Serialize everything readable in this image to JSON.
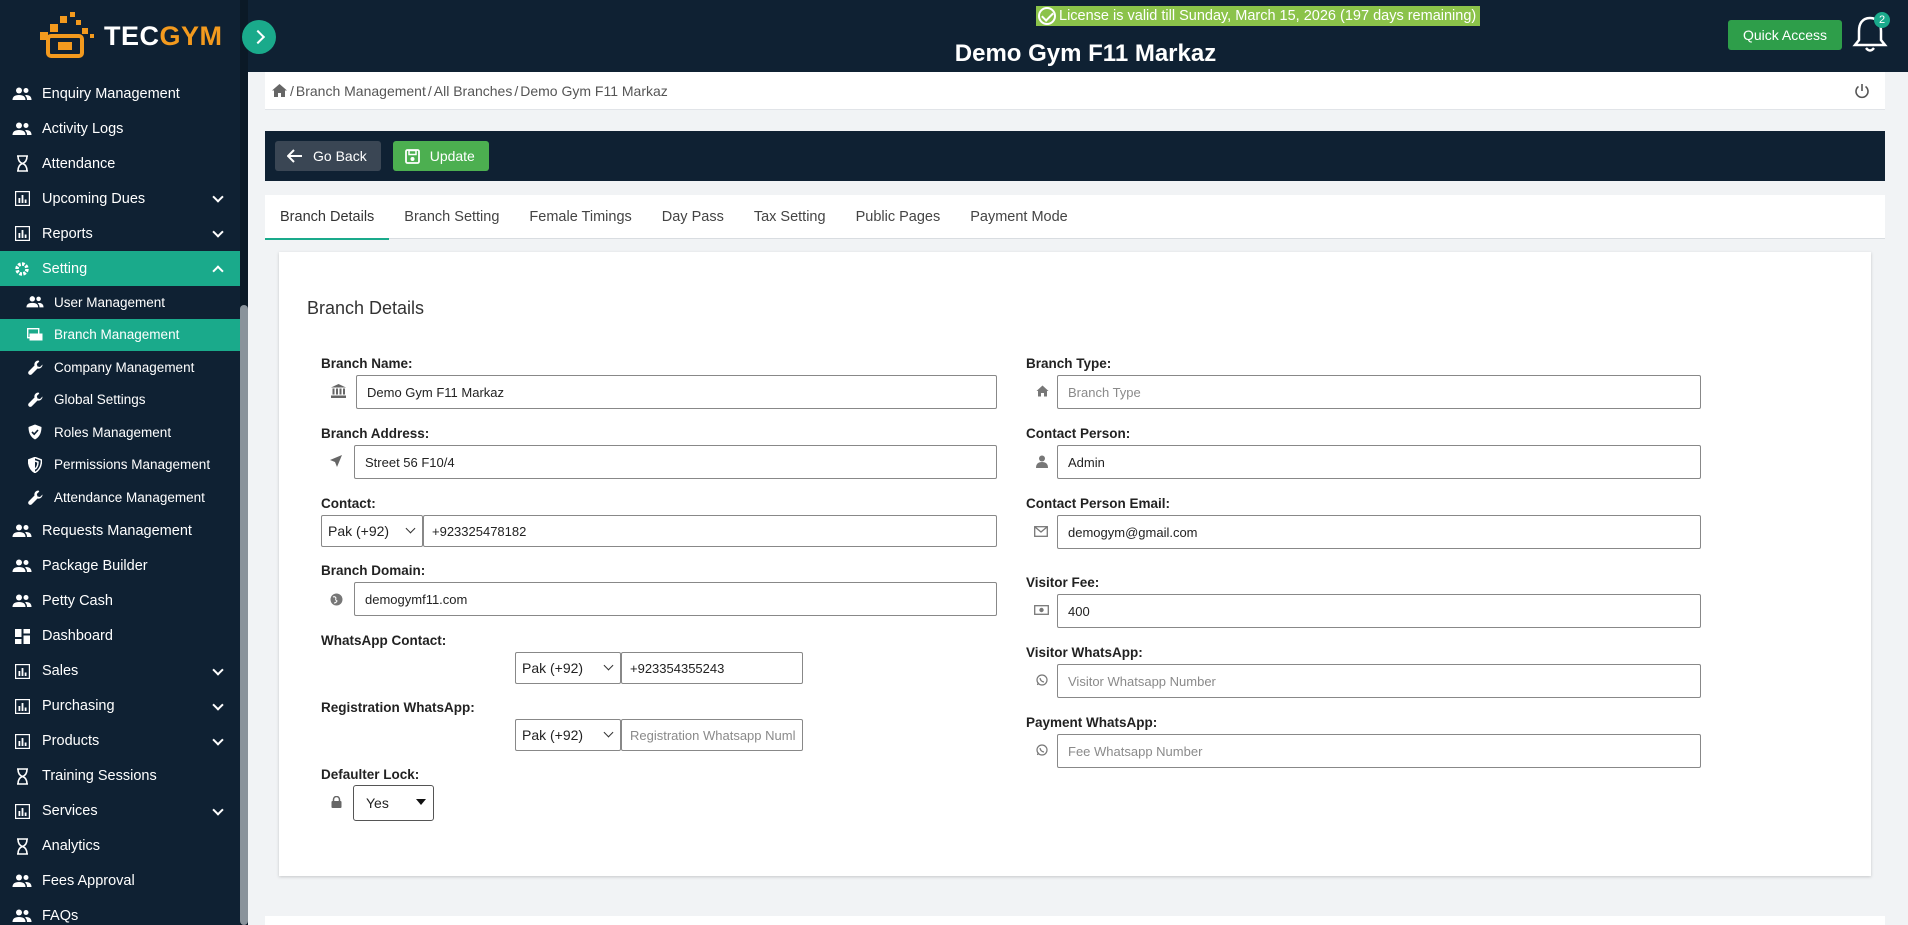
{
  "app": {
    "logo_tec": "TEC",
    "logo_gym": "GYM"
  },
  "sidebar": {
    "items": [
      {
        "label": "Enquiry Management",
        "icon": "users-icon",
        "has_chevron": false
      },
      {
        "label": "Activity Logs",
        "icon": "users-icon",
        "has_chevron": false
      },
      {
        "label": "Attendance",
        "icon": "hourglass-icon",
        "has_chevron": false
      },
      {
        "label": "Upcoming Dues",
        "icon": "bar-chart-icon",
        "has_chevron": true
      },
      {
        "label": "Reports",
        "icon": "bar-chart-icon",
        "has_chevron": true
      },
      {
        "label": "Setting",
        "icon": "gear-icon",
        "has_chevron": true,
        "active": true
      }
    ],
    "setting_sub": [
      {
        "label": "User Management",
        "icon": "users-icon"
      },
      {
        "label": "Branch Management",
        "icon": "branch-icon",
        "active": true
      },
      {
        "label": "Company Management",
        "icon": "wrench-icon"
      },
      {
        "label": "Global Settings",
        "icon": "wrench-icon"
      },
      {
        "label": "Roles Management",
        "icon": "shield-check-icon"
      },
      {
        "label": "Permissions Management",
        "icon": "shield-half-icon"
      },
      {
        "label": "Attendance Management",
        "icon": "wrench-icon"
      }
    ],
    "items_after": [
      {
        "label": "Requests Management",
        "icon": "users-icon",
        "has_chevron": false
      },
      {
        "label": "Package Builder",
        "icon": "users-icon",
        "has_chevron": false
      },
      {
        "label": "Petty Cash",
        "icon": "users-icon",
        "has_chevron": false
      },
      {
        "label": "Dashboard",
        "icon": "dashboard-icon",
        "has_chevron": false
      },
      {
        "label": "Sales",
        "icon": "bar-chart-icon",
        "has_chevron": true
      },
      {
        "label": "Purchasing",
        "icon": "bar-chart-icon",
        "has_chevron": true
      },
      {
        "label": "Products",
        "icon": "bar-chart-icon",
        "has_chevron": true
      },
      {
        "label": "Training Sessions",
        "icon": "hourglass-icon",
        "has_chevron": false
      },
      {
        "label": "Services",
        "icon": "bar-chart-icon",
        "has_chevron": true
      },
      {
        "label": "Analytics",
        "icon": "hourglass-icon",
        "has_chevron": false
      },
      {
        "label": "Fees Approval",
        "icon": "users-icon",
        "has_chevron": false
      },
      {
        "label": "FAQs",
        "icon": "users-icon",
        "has_chevron": false
      }
    ]
  },
  "topbar": {
    "license": "License is valid till Sunday, March 15, 2026 (197 days remaining)",
    "title": "Demo Gym F11 Markaz",
    "quick_access": "Quick Access",
    "notifications_count": "2"
  },
  "breadcrumb": {
    "items": [
      "Branch Management",
      "All Branches",
      "Demo Gym F11 Markaz"
    ]
  },
  "actions": {
    "back": "Go Back",
    "update": "Update"
  },
  "tabs": [
    "Branch Details",
    "Branch Setting",
    "Female Timings",
    "Day Pass",
    "Tax Setting",
    "Public Pages",
    "Payment Mode"
  ],
  "form": {
    "title": "Branch Details",
    "branch_name": {
      "label": "Branch Name:",
      "value": "Demo Gym F11 Markaz"
    },
    "branch_address": {
      "label": "Branch Address:",
      "value": "Street 56 F10/4"
    },
    "contact": {
      "label": "Contact:",
      "country": "Pak (+92)",
      "value": "+923325478182"
    },
    "branch_domain": {
      "label": "Branch Domain:",
      "value": "demogymf11.com"
    },
    "whatsapp_contact": {
      "label": "WhatsApp Contact:",
      "country": "Pak (+92)",
      "value": "+923354355243"
    },
    "registration_whatsapp": {
      "label": "Registration WhatsApp:",
      "country": "Pak (+92)",
      "placeholder": "Registration Whatsapp Numl"
    },
    "defaulter_lock": {
      "label": "Defaulter Lock:",
      "value": "Yes"
    },
    "branch_type": {
      "label": "Branch Type:",
      "placeholder": "Branch Type"
    },
    "contact_person": {
      "label": "Contact Person:",
      "value": "Admin"
    },
    "contact_person_email": {
      "label": "Contact Person Email:",
      "value": "demogym@gmail.com"
    },
    "visitor_fee": {
      "label": "Visitor Fee:",
      "value": "400"
    },
    "visitor_whatsapp": {
      "label": "Visitor WhatsApp:",
      "placeholder": "Visitor Whatsapp Number"
    },
    "payment_whatsapp": {
      "label": "Payment WhatsApp:",
      "placeholder": "Fee Whatsapp Number"
    }
  },
  "colors": {
    "navy": "#0f2133",
    "teal": "#1aaa8b",
    "green": "#4caf50",
    "license_bg": "#8bc34a",
    "orange": "#f39a1e"
  }
}
